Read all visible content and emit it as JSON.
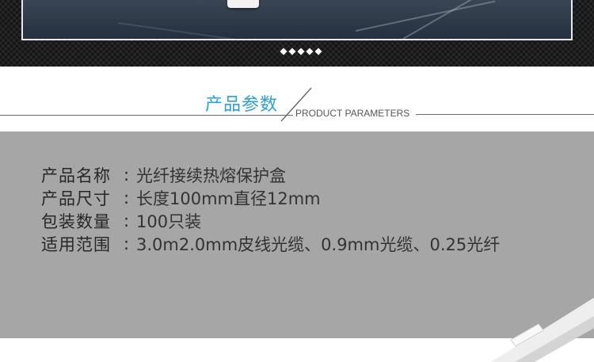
{
  "banner": {
    "dots_count": 5,
    "dot_icon": "diamond-dot-icon"
  },
  "section_title": {
    "cn": "产品参数",
    "en": "PRODUCT PARAMETERS",
    "color": "#2d9fd8"
  },
  "params": [
    {
      "label": "产品名称",
      "colon": ":",
      "value": "光纤接续热熔保护盒"
    },
    {
      "label": "产品尺寸",
      "colon": ":",
      "value": "长度100mm直径12mm"
    },
    {
      "label": "包装数量",
      "colon": ":",
      "value": "100只装"
    },
    {
      "label": "适用范围",
      "colon": ":",
      "value": "3.0m2.0mm皮线光缆、0.9mm光缆、0.25光纤"
    }
  ],
  "colors": {
    "banner_bg": "#151515",
    "params_bg": "#a6a6a6",
    "text": "#262626"
  }
}
